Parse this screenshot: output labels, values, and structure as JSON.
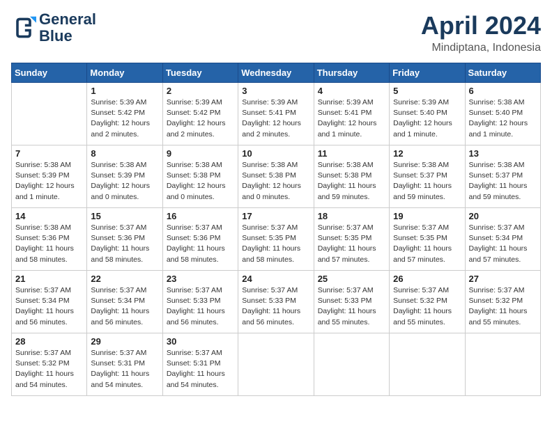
{
  "logo": {
    "line1": "General",
    "line2": "Blue"
  },
  "title": "April 2024",
  "subtitle": "Mindiptana, Indonesia",
  "days_of_week": [
    "Sunday",
    "Monday",
    "Tuesday",
    "Wednesday",
    "Thursday",
    "Friday",
    "Saturday"
  ],
  "weeks": [
    [
      {
        "day": null,
        "info": null
      },
      {
        "day": "1",
        "info": "Sunrise: 5:39 AM\nSunset: 5:42 PM\nDaylight: 12 hours\nand 2 minutes."
      },
      {
        "day": "2",
        "info": "Sunrise: 5:39 AM\nSunset: 5:42 PM\nDaylight: 12 hours\nand 2 minutes."
      },
      {
        "day": "3",
        "info": "Sunrise: 5:39 AM\nSunset: 5:41 PM\nDaylight: 12 hours\nand 2 minutes."
      },
      {
        "day": "4",
        "info": "Sunrise: 5:39 AM\nSunset: 5:41 PM\nDaylight: 12 hours\nand 1 minute."
      },
      {
        "day": "5",
        "info": "Sunrise: 5:39 AM\nSunset: 5:40 PM\nDaylight: 12 hours\nand 1 minute."
      },
      {
        "day": "6",
        "info": "Sunrise: 5:38 AM\nSunset: 5:40 PM\nDaylight: 12 hours\nand 1 minute."
      }
    ],
    [
      {
        "day": "7",
        "info": "Sunrise: 5:38 AM\nSunset: 5:39 PM\nDaylight: 12 hours\nand 1 minute."
      },
      {
        "day": "8",
        "info": "Sunrise: 5:38 AM\nSunset: 5:39 PM\nDaylight: 12 hours\nand 0 minutes."
      },
      {
        "day": "9",
        "info": "Sunrise: 5:38 AM\nSunset: 5:38 PM\nDaylight: 12 hours\nand 0 minutes."
      },
      {
        "day": "10",
        "info": "Sunrise: 5:38 AM\nSunset: 5:38 PM\nDaylight: 12 hours\nand 0 minutes."
      },
      {
        "day": "11",
        "info": "Sunrise: 5:38 AM\nSunset: 5:38 PM\nDaylight: 11 hours\nand 59 minutes."
      },
      {
        "day": "12",
        "info": "Sunrise: 5:38 AM\nSunset: 5:37 PM\nDaylight: 11 hours\nand 59 minutes."
      },
      {
        "day": "13",
        "info": "Sunrise: 5:38 AM\nSunset: 5:37 PM\nDaylight: 11 hours\nand 59 minutes."
      }
    ],
    [
      {
        "day": "14",
        "info": "Sunrise: 5:38 AM\nSunset: 5:36 PM\nDaylight: 11 hours\nand 58 minutes."
      },
      {
        "day": "15",
        "info": "Sunrise: 5:37 AM\nSunset: 5:36 PM\nDaylight: 11 hours\nand 58 minutes."
      },
      {
        "day": "16",
        "info": "Sunrise: 5:37 AM\nSunset: 5:36 PM\nDaylight: 11 hours\nand 58 minutes."
      },
      {
        "day": "17",
        "info": "Sunrise: 5:37 AM\nSunset: 5:35 PM\nDaylight: 11 hours\nand 58 minutes."
      },
      {
        "day": "18",
        "info": "Sunrise: 5:37 AM\nSunset: 5:35 PM\nDaylight: 11 hours\nand 57 minutes."
      },
      {
        "day": "19",
        "info": "Sunrise: 5:37 AM\nSunset: 5:35 PM\nDaylight: 11 hours\nand 57 minutes."
      },
      {
        "day": "20",
        "info": "Sunrise: 5:37 AM\nSunset: 5:34 PM\nDaylight: 11 hours\nand 57 minutes."
      }
    ],
    [
      {
        "day": "21",
        "info": "Sunrise: 5:37 AM\nSunset: 5:34 PM\nDaylight: 11 hours\nand 56 minutes."
      },
      {
        "day": "22",
        "info": "Sunrise: 5:37 AM\nSunset: 5:34 PM\nDaylight: 11 hours\nand 56 minutes."
      },
      {
        "day": "23",
        "info": "Sunrise: 5:37 AM\nSunset: 5:33 PM\nDaylight: 11 hours\nand 56 minutes."
      },
      {
        "day": "24",
        "info": "Sunrise: 5:37 AM\nSunset: 5:33 PM\nDaylight: 11 hours\nand 56 minutes."
      },
      {
        "day": "25",
        "info": "Sunrise: 5:37 AM\nSunset: 5:33 PM\nDaylight: 11 hours\nand 55 minutes."
      },
      {
        "day": "26",
        "info": "Sunrise: 5:37 AM\nSunset: 5:32 PM\nDaylight: 11 hours\nand 55 minutes."
      },
      {
        "day": "27",
        "info": "Sunrise: 5:37 AM\nSunset: 5:32 PM\nDaylight: 11 hours\nand 55 minutes."
      }
    ],
    [
      {
        "day": "28",
        "info": "Sunrise: 5:37 AM\nSunset: 5:32 PM\nDaylight: 11 hours\nand 54 minutes."
      },
      {
        "day": "29",
        "info": "Sunrise: 5:37 AM\nSunset: 5:31 PM\nDaylight: 11 hours\nand 54 minutes."
      },
      {
        "day": "30",
        "info": "Sunrise: 5:37 AM\nSunset: 5:31 PM\nDaylight: 11 hours\nand 54 minutes."
      },
      {
        "day": null,
        "info": null
      },
      {
        "day": null,
        "info": null
      },
      {
        "day": null,
        "info": null
      },
      {
        "day": null,
        "info": null
      }
    ]
  ]
}
